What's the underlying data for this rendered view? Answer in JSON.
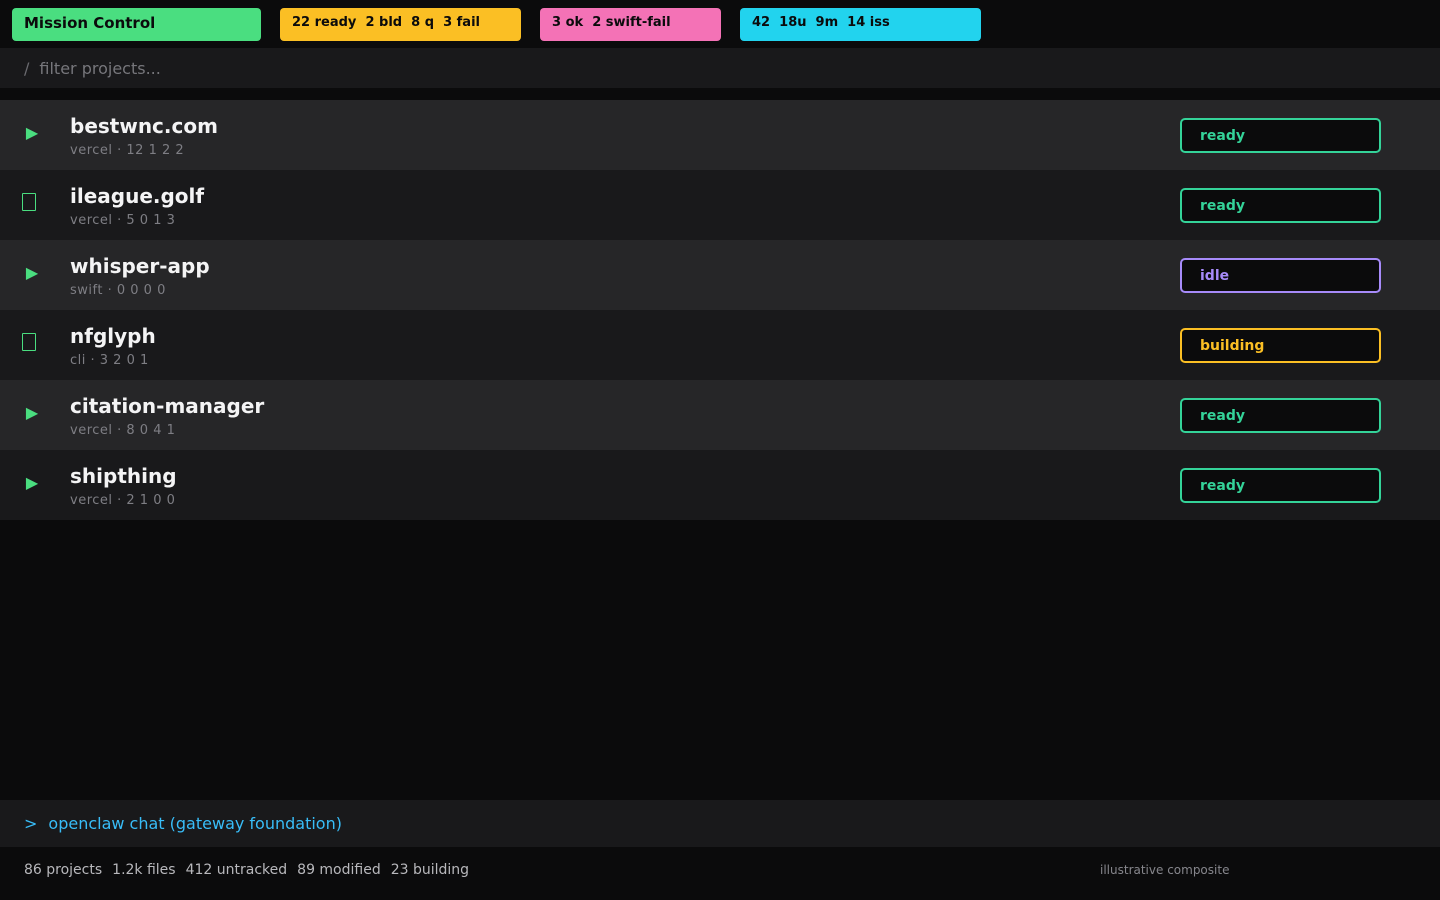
{
  "header": {
    "title": "Mission Control",
    "pills": [
      {
        "text": "22 ready  2 bld  8 q  3 fail",
        "color": "#fbbf24"
      },
      {
        "text": "3 ok  2 swift-fail",
        "color": "#f472b6"
      },
      {
        "text": "42  18u  9m  14 iss",
        "color": "#22d3ee"
      }
    ]
  },
  "filter": {
    "prefix": "/",
    "placeholder": "filter projects..."
  },
  "projects": [
    {
      "name": "bestwnc.com",
      "meta": "vercel · 12 1 2 2",
      "icon": "play-icon",
      "status": "ready",
      "status_color": "#34d399"
    },
    {
      "name": "ileague.golf",
      "meta": "vercel · 5 0 1 3",
      "icon": "missing-glyph-icon",
      "status": "ready",
      "status_color": "#34d399"
    },
    {
      "name": "whisper-app",
      "meta": "swift · 0 0 0 0",
      "icon": "play-icon",
      "status": "idle",
      "status_color": "#a78bfa"
    },
    {
      "name": "nfglyph",
      "meta": "cli · 3 2 0 1",
      "icon": "missing-glyph-icon",
      "status": "building",
      "status_color": "#fbbf24"
    },
    {
      "name": "citation-manager",
      "meta": "vercel · 8 0 4 1",
      "icon": "play-icon",
      "status": "ready",
      "status_color": "#34d399"
    },
    {
      "name": "shipthing",
      "meta": "vercel · 2 1 0 0",
      "icon": "play-icon",
      "status": "ready",
      "status_color": "#34d399"
    }
  ],
  "icons": {
    "play": "▶"
  },
  "chat": {
    "prompt": ">",
    "text": "openclaw chat (gateway foundation)",
    "color": "#38bdf8"
  },
  "footer": {
    "stats": [
      "86 projects",
      "1.2k files",
      "412 untracked",
      "89 modified",
      "23 building"
    ],
    "note": "illustrative composite"
  },
  "colors": {
    "accent_green": "#4ade80"
  }
}
